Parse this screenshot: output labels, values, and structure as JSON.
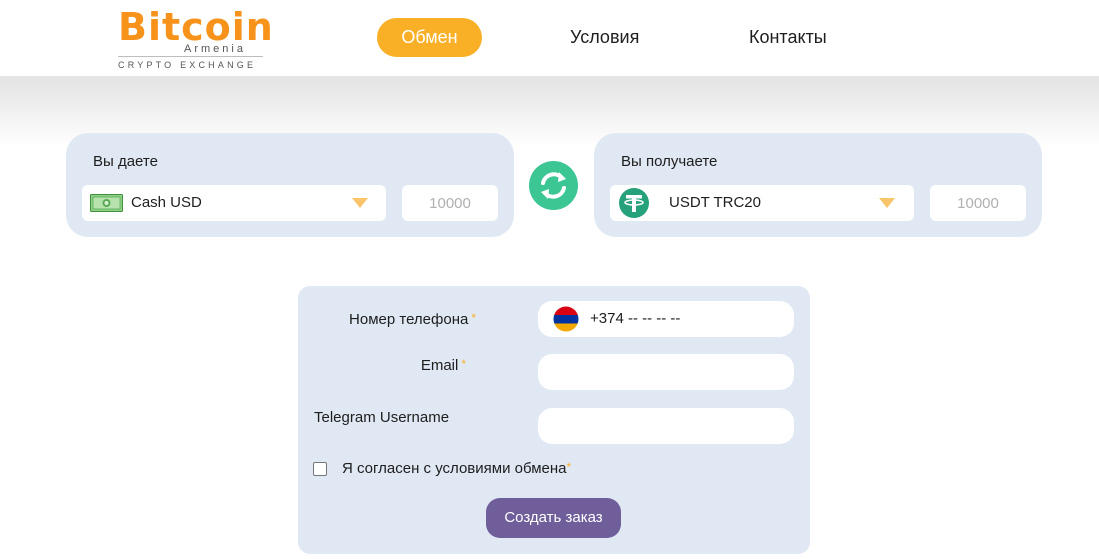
{
  "header": {
    "logo": {
      "word": "Bitcoin",
      "sub": "Armenia",
      "tagline": "CRYPTO EXCHANGE"
    },
    "nav": [
      {
        "label": "Обмен",
        "active": true
      },
      {
        "label": "Условия",
        "active": false
      },
      {
        "label": "Контакты",
        "active": false
      }
    ]
  },
  "exchange": {
    "give": {
      "label": "Вы даете",
      "currency": "Cash USD",
      "icon": "banknote-icon",
      "amount_placeholder": "10000"
    },
    "swap_icon": "swap-arrows-icon",
    "receive": {
      "label": "Вы получаете",
      "currency": "USDT TRC20",
      "icon": "tether-icon",
      "amount_placeholder": "10000"
    }
  },
  "form": {
    "phone": {
      "label": "Номер телефона",
      "required_mark": "*",
      "prefix": "+374 -- -- -- --",
      "flag_icon": "armenia-flag-icon"
    },
    "email": {
      "label": "Email",
      "required_mark": "*",
      "value": ""
    },
    "telegram": {
      "label": "Telegram Username",
      "value": ""
    },
    "agree": {
      "label": "Я согласен с условиями обмена",
      "required_mark": "*",
      "checked": false
    },
    "submit_label": "Создать заказ"
  },
  "colors": {
    "accent": "#f9b026",
    "panel": "#dfe8f3",
    "swap": "#3cc694",
    "submit": "#6f5e9a",
    "tether": "#26a17b",
    "caret": "#f9c56a"
  }
}
